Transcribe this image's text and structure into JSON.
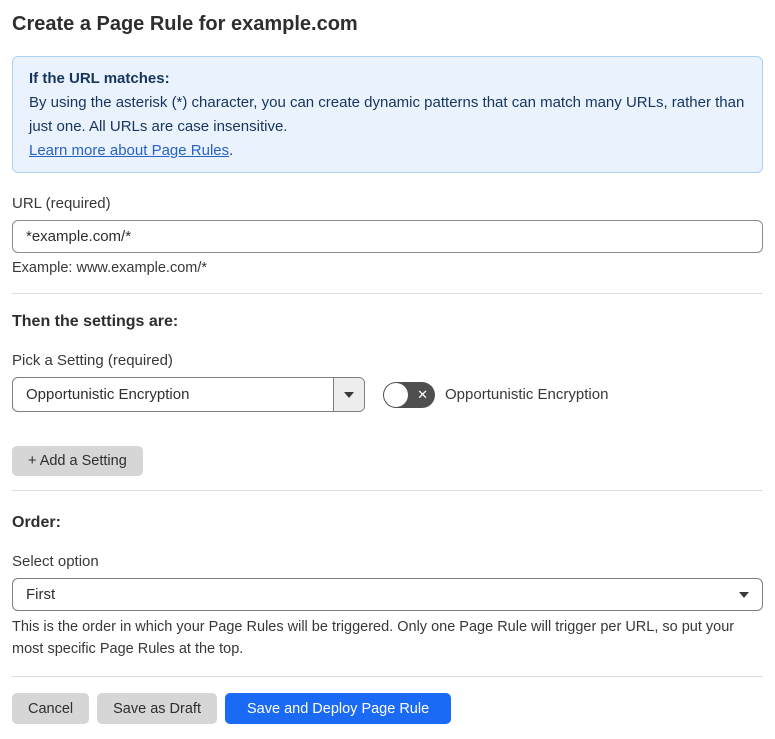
{
  "page": {
    "title": "Create a Page Rule for example.com"
  },
  "info_box": {
    "heading": "If the URL matches:",
    "body": "By using the asterisk (*) character, you can create dynamic patterns that can match many URLs, rather than just one. All URLs are case insensitive.",
    "link_label": "Learn more about Page Rules",
    "link_suffix": "."
  },
  "url_field": {
    "label": "URL (required)",
    "value": "*example.com/*",
    "helper": "Example: www.example.com/*"
  },
  "settings_section": {
    "heading": "Then the settings are:",
    "picker_label": "Pick a Setting (required)",
    "selected_setting": "Opportunistic Encryption",
    "toggle": {
      "state": "off",
      "label": "Opportunistic Encryption"
    },
    "add_button_label": "+ Add a Setting"
  },
  "order_section": {
    "heading": "Order:",
    "select_label": "Select option",
    "selected_option": "First",
    "helper": "This is the order in which your Page Rules will be triggered. Only one Page Rule will trigger per URL, so put your most specific Page Rules at the top."
  },
  "footer": {
    "cancel_label": "Cancel",
    "save_draft_label": "Save as Draft",
    "save_deploy_label": "Save and Deploy Page Rule"
  },
  "colors": {
    "accent_blue": "#1a6af5",
    "info_bg": "#e9f2fd",
    "info_border": "#b0d0f0",
    "info_text": "#16355d",
    "link_blue": "#2962c6",
    "toggle_off_bg": "#4f4f4f",
    "gray_button_bg": "#d6d6d6"
  }
}
